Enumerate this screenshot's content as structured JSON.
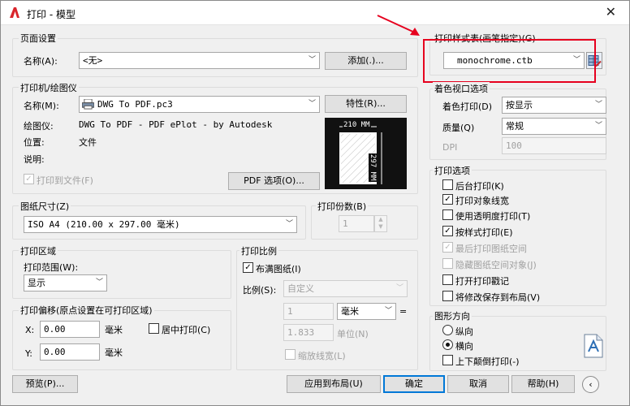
{
  "window": {
    "title": "打印 - 模型"
  },
  "page_setup": {
    "group": "页面设置",
    "name_label": "名称(A):",
    "name_value": "<无>",
    "add_button": "添加(.)..."
  },
  "printer": {
    "group": "打印机/绘图仪",
    "name_label": "名称(M):",
    "name_value": "DWG To PDF.pc3",
    "properties_button": "特性(R)...",
    "plotter_label": "绘图仪:",
    "plotter_value": "DWG To PDF - PDF ePlot - by Autodesk",
    "location_label": "位置:",
    "location_value": "文件",
    "description_label": "说明:",
    "print_to_file": "打印到文件(F)",
    "pdf_options_button": "PDF 选项(O)...",
    "preview_width": "210 MM",
    "preview_height": "297 MM"
  },
  "paper_size": {
    "group": "图纸尺寸(Z)",
    "value": "ISO A4 (210.00 x 297.00 毫米)"
  },
  "copies": {
    "group": "打印份数(B)",
    "value": "1"
  },
  "plot_area": {
    "group": "打印区域",
    "range_label": "打印范围(W):",
    "range_value": "显示"
  },
  "plot_offset": {
    "group": "打印偏移(原点设置在可打印区域)",
    "x_label": "X:",
    "x_value": "0.00",
    "x_unit": "毫米",
    "y_label": "Y:",
    "y_value": "0.00",
    "y_unit": "毫米",
    "center": "居中打印(C)"
  },
  "plot_scale": {
    "group": "打印比例",
    "fit_paper": "布满图纸(I)",
    "scale_label": "比例(S):",
    "scale_value": "自定义",
    "value1": "1",
    "unit1": "毫米",
    "equals": "=",
    "value2": "1.833",
    "unit2": "单位(N)",
    "scale_lineweights": "缩放线宽(L)"
  },
  "plot_style_table": {
    "group": "打印样式表(画笔指定)(G)",
    "value": "monochrome.ctb"
  },
  "shaded_viewport": {
    "group": "着色视口选项",
    "shade_label": "着色打印(D)",
    "shade_value": "按显示",
    "quality_label": "质量(Q)",
    "quality_value": "常规",
    "dpi_label": "DPI",
    "dpi_value": "100"
  },
  "plot_options": {
    "group": "打印选项",
    "items": [
      {
        "label": "后台打印(K)",
        "mark": ""
      },
      {
        "label": "打印对象线宽",
        "mark": "✓"
      },
      {
        "label": "使用透明度打印(T)",
        "mark": ""
      },
      {
        "label": "按样式打印(E)",
        "mark": "✓"
      },
      {
        "label": "最后打印图纸空间",
        "mark": "✓"
      },
      {
        "label": "隐藏图纸空间对象(J)",
        "mark": ""
      },
      {
        "label": "打开打印戳记",
        "mark": ""
      },
      {
        "label": "将修改保存到布局(V)",
        "mark": ""
      }
    ]
  },
  "orientation": {
    "group": "图形方向",
    "portrait": "纵向",
    "landscape": "横向",
    "upside_down": "上下颠倒打印(-)"
  },
  "footer": {
    "preview": "预览(P)...",
    "apply": "应用到布局(U)",
    "ok": "确定",
    "cancel": "取消",
    "help": "帮助(H)"
  },
  "colors": {
    "annotation_red": "#e6001e",
    "default_button": "#0078d7"
  }
}
